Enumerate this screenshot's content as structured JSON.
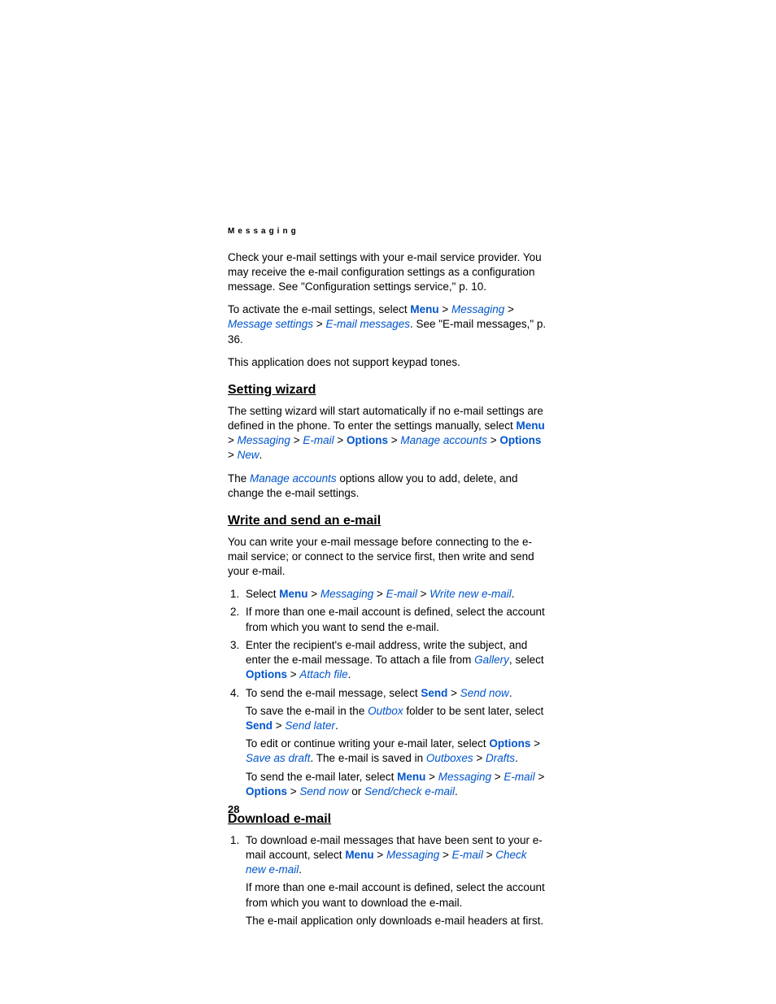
{
  "header": "Messaging",
  "p1_a": "Check your e-mail settings with your e-mail service provider. You may receive the e-mail configuration settings as a configuration message. See \"Configuration settings service,\" p. 10.",
  "p2_pre": "To activate the e-mail settings, select ",
  "menu": "Menu",
  "gt": " > ",
  "messaging": "Messaging",
  "message_settings": "Message settings",
  "email_messages": "E-mail messages",
  "p2_post": ". See \"E-mail messages,\" p. 36.",
  "p3": "This application does not support keypad tones.",
  "h1": "Setting wizard",
  "sw_p1_a": "The setting wizard will start automatically if no e-mail settings are defined in the phone. To enter the settings manually, select ",
  "email": "E-mail",
  "options": "Options",
  "manage_accounts": "Manage accounts",
  "new": "New",
  "period": ".",
  "sw_p2_a": "The ",
  "sw_p2_b": " options allow you to add, delete, and change the e-mail settings.",
  "h2": "Write and send an e-mail",
  "ws_p1": "You can write your e-mail message before connecting to the e-mail service; or connect to the service first, then write and send your e-mail.",
  "li1_a": "Select ",
  "write_new_email": "Write new e-mail",
  "li2": "If more than one e-mail account is defined, select the account from which you want to send the e-mail.",
  "li3_a": "Enter the recipient's e-mail address, write the subject, and enter the e-mail message. To attach a file from ",
  "gallery": "Gallery",
  "li3_b": ", select ",
  "attach_file": "Attach file",
  "li4_a": "To send the e-mail message, select ",
  "send": "Send",
  "send_now": "Send now",
  "li4_b_a": "To save the e-mail in the ",
  "outbox": "Outbox",
  "li4_b_b": " folder to be sent later, select ",
  "send_later": "Send later",
  "li4_c_a": "To edit or continue writing your e-mail later, select ",
  "save_as_draft": "Save as draft",
  "li4_c_b": ". The e-mail is saved in ",
  "outboxes": "Outboxes",
  "drafts": "Drafts",
  "li4_d_a": "To send the e-mail later, select ",
  "or": " or ",
  "send_check_email": "Send/check e-mail",
  "h3": "Download e-mail",
  "dl_li1_a": "To download e-mail messages that have been sent to your e-mail account, select ",
  "check_new_email": "Check new e-mail",
  "dl_li1_b": "If more than one e-mail account is defined, select the account from which you want to download the e-mail.",
  "dl_li1_c": "The e-mail application only downloads e-mail headers at first.",
  "page_number": "28"
}
